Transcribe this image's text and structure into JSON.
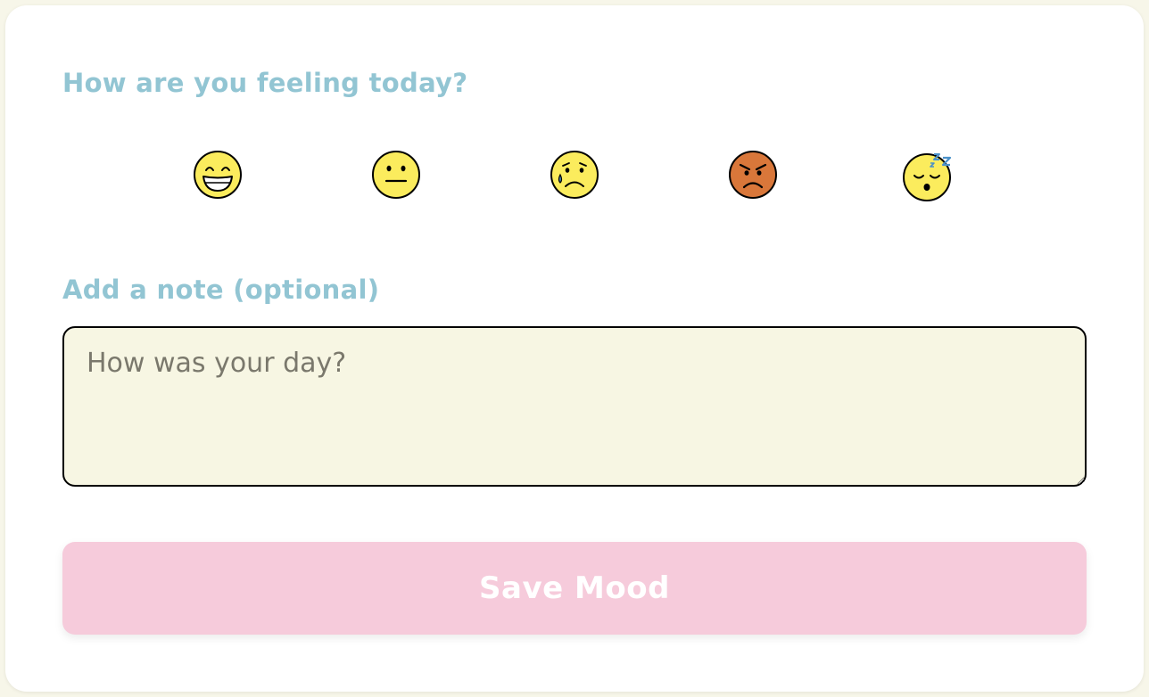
{
  "question": "How are you feeling today?",
  "moods": [
    {
      "label": "happy",
      "icon": "grinning-face-icon",
      "color": "#fbec5d"
    },
    {
      "label": "neutral",
      "icon": "neutral-face-icon",
      "color": "#fbec5d"
    },
    {
      "label": "sad",
      "icon": "crying-face-icon",
      "color": "#fbec5d"
    },
    {
      "label": "angry",
      "icon": "angry-face-icon",
      "color": "#d9773a"
    },
    {
      "label": "tired",
      "icon": "sleeping-face-icon",
      "color": "#fbec5d"
    }
  ],
  "note": {
    "label": "Add a note (optional)",
    "placeholder": "How was your day?",
    "value": ""
  },
  "save_button": {
    "label": "Save Mood"
  },
  "colors": {
    "heading": "#92c5d3",
    "button_bg": "#f6cbdb",
    "button_text": "#ffffff",
    "textarea_bg": "#f7f6e3",
    "page_bg": "#f7f6e9"
  }
}
